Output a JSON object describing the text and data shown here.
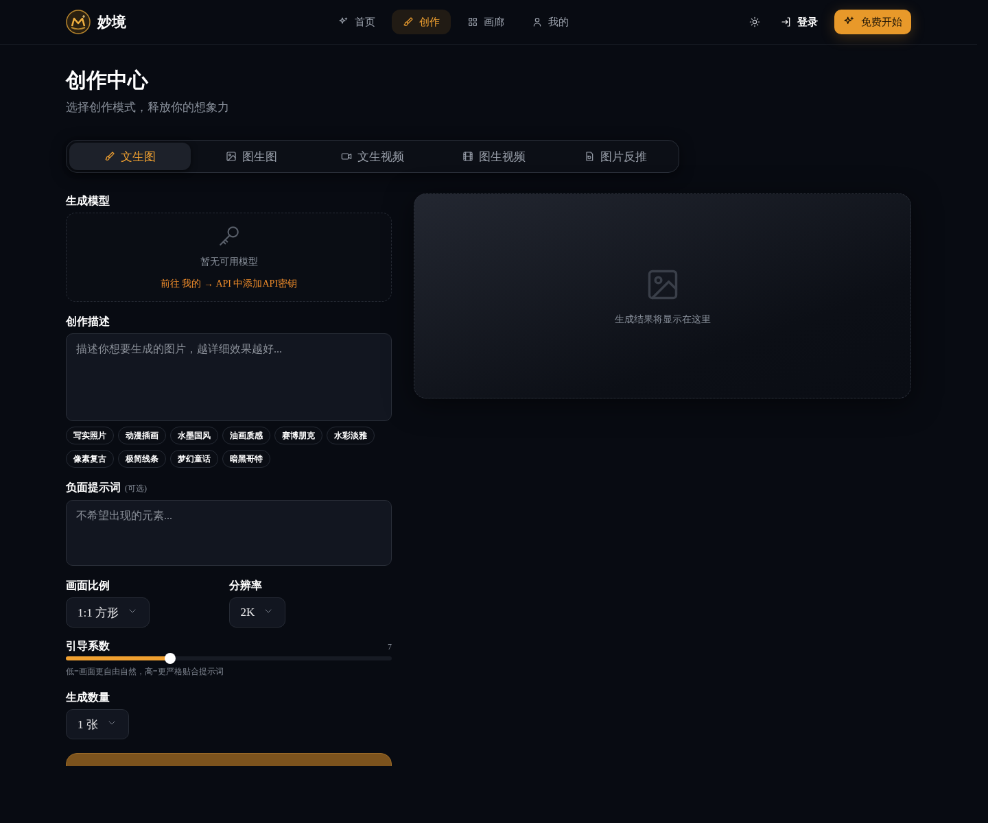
{
  "brand": {
    "name": "妙境"
  },
  "nav": [
    {
      "label": "首页",
      "selected": false
    },
    {
      "label": "创作",
      "selected": true
    },
    {
      "label": "画廊",
      "selected": false
    },
    {
      "label": "我的",
      "selected": false
    }
  ],
  "actions": {
    "login": "登录",
    "cta": "免费开始"
  },
  "page": {
    "title": "创作中心",
    "subtitle": "选择创作模式，释放你的想象力"
  },
  "modes": [
    {
      "label": "文生图",
      "selected": true
    },
    {
      "label": "图生图",
      "selected": false
    },
    {
      "label": "文生视频",
      "selected": false
    },
    {
      "label": "图生视频",
      "selected": false
    },
    {
      "label": "图片反推",
      "selected": false
    }
  ],
  "form": {
    "model": {
      "label": "生成模型",
      "empty": "暂无可用模型",
      "hint": "前往 我的 → API 中添加API密钥"
    },
    "prompt": {
      "label": "创作描述",
      "placeholder": "描述你想要生成的图片，越详细效果越好..."
    },
    "styles": [
      "写实照片",
      "动漫插画",
      "水墨国风",
      "油画质感",
      "赛博朋克",
      "水彩淡雅",
      "像素复古",
      "极简线条",
      "梦幻童话",
      "暗黑哥特"
    ],
    "negative": {
      "label": "负面提示词",
      "note": "(可选)",
      "placeholder": "不希望出现的元素..."
    },
    "aspect": {
      "label": "画面比例",
      "value": "1:1 方形"
    },
    "resolution": {
      "label": "分辨率",
      "value": "2K"
    },
    "guidance": {
      "label": "引导系数",
      "reading": "7",
      "level": 0.32,
      "hint": "低=画面更自由自然，高=更严格贴合提示词"
    },
    "count": {
      "label": "生成数量",
      "value": "1 张"
    }
  },
  "result": {
    "placeholder": "生成结果将显示在这里"
  }
}
